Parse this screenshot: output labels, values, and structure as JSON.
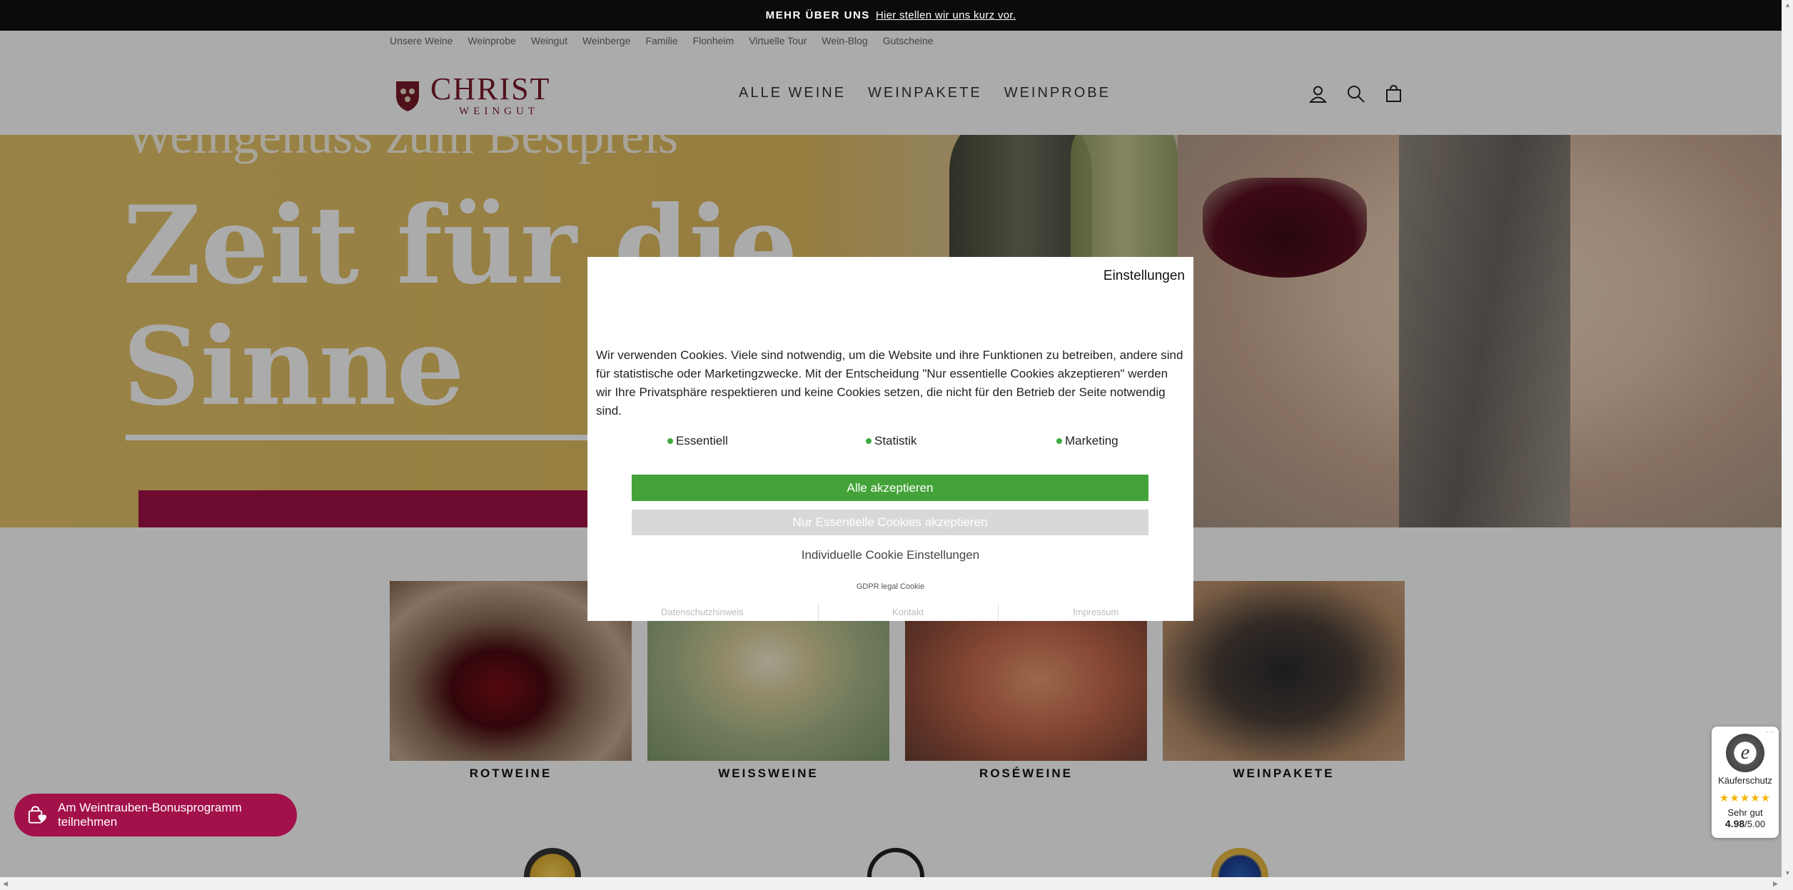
{
  "announcement": {
    "label": "MEHR ÜBER UNS",
    "link": "Hier stellen wir uns kurz vor."
  },
  "top_links": [
    "Unsere Weine",
    "Weinprobe",
    "Weingut",
    "Weinberge",
    "Familie",
    "Flonheim",
    "Virtuelle Tour",
    "Wein-Blog",
    "Gutscheine"
  ],
  "logo": {
    "main": "CHRIST",
    "sub": "WEINGUT"
  },
  "main_nav": [
    "ALLE WEINE",
    "WEINPAKETE",
    "WEINPROBE"
  ],
  "header_icons": [
    "account-icon",
    "search-icon",
    "cart-icon"
  ],
  "hero": {
    "subtitle": "Weingenuss zum Bestpreis",
    "title_line1": "Zeit für die",
    "title_line2": "Sinne"
  },
  "categories": [
    {
      "name": "ROTWEINE"
    },
    {
      "name": "WEISSWEINE"
    },
    {
      "name": "ROSÉWEINE"
    },
    {
      "name": "WEINPAKETE"
    }
  ],
  "bonus": {
    "label": "Am Weintrauben-Bonusprogramm teilnehmen"
  },
  "trusted_shops": {
    "label": "Käuferschutz",
    "stars": "★★★★★",
    "rating_text": "Sehr gut",
    "score": "4.98",
    "max": "/5.00",
    "dots": "···"
  },
  "cookie_modal": {
    "settings": "Einstellungen",
    "text": "Wir verwenden Cookies. Viele sind notwendig, um die Website und ihre Funktionen zu betreiben, andere sind für statistische oder Marketingzwecke. Mit der Entscheidung \"Nur essentielle Cookies akzeptieren\" werden wir Ihre Privatsphäre respektieren und keine Cookies setzen, die nicht für den Betrieb der Seite notwendig sind.",
    "categories": [
      "Essentiell",
      "Statistik",
      "Marketing"
    ],
    "accept_all": "Alle akzeptieren",
    "essential_only": "Nur Essentielle Cookies akzeptieren",
    "individual": "Individuelle Cookie Einstellungen",
    "gdpr": "GDPR legal Cookie",
    "links": [
      "Datenschutzhinweis",
      "Kontakt",
      "Impressum"
    ]
  },
  "colors": {
    "accent": "#a3114a",
    "accept": "#44a338",
    "brand": "#7a1a2a"
  }
}
